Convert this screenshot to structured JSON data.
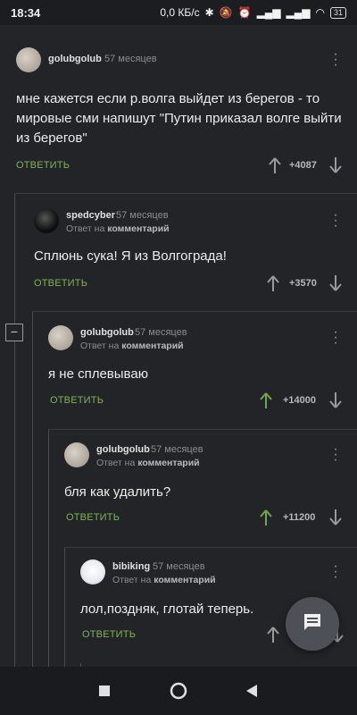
{
  "status": {
    "time": "18:34",
    "speed": "0,0 КБ/с",
    "battery": "31"
  },
  "comments": [
    {
      "username": "golubgolub",
      "ago": "57 месяцев",
      "reply_to_prefix": "",
      "reply_to_link": "",
      "text": "мне кажется если р.волга выйдет из берегов - то мировые сми напишут \"Путин приказал волге выйти из берегов\"",
      "reply_label": "ОТВЕТИТЬ",
      "score": "+4087"
    },
    {
      "username": "spedcyber",
      "ago": "57 месяцев",
      "reply_to_prefix": "Ответ на ",
      "reply_to_link": "комментарий",
      "text": "Сплюнь сука! Я из Волгограда!",
      "reply_label": "ОТВЕТИТЬ",
      "score": "+3570"
    },
    {
      "username": "golubgolub",
      "ago": "57 месяцев",
      "reply_to_prefix": "Ответ на ",
      "reply_to_link": "комментарий",
      "text": "я не сплевываю",
      "reply_label": "ОТВЕТИТЬ",
      "score": "+14000"
    },
    {
      "username": "golubgolub",
      "ago": "57 месяцев",
      "reply_to_prefix": "Ответ на ",
      "reply_to_link": "комментарий",
      "text": "бля как удалить?",
      "reply_label": "ОТВЕТИТЬ",
      "score": "+11200"
    },
    {
      "username": "bibiking",
      "ago": "57 месяцев",
      "reply_to_prefix": "Ответ на ",
      "reply_to_link": "комментарий",
      "text": "лол,поздняк, глотай теперь.",
      "reply_label": "ОТВЕТИТЬ",
      "score": ""
    }
  ],
  "collapse_symbol": "−",
  "colors": {
    "accent_green": "#7fb35a",
    "upvoted_arrow": "#6fa84a",
    "neutral_arrow": "#9a9a9a",
    "background": "#222427"
  },
  "icons": {
    "fab": "comment-icon",
    "nav_recent": "square-icon",
    "nav_home": "circle-icon",
    "nav_back": "triangle-back-icon"
  }
}
